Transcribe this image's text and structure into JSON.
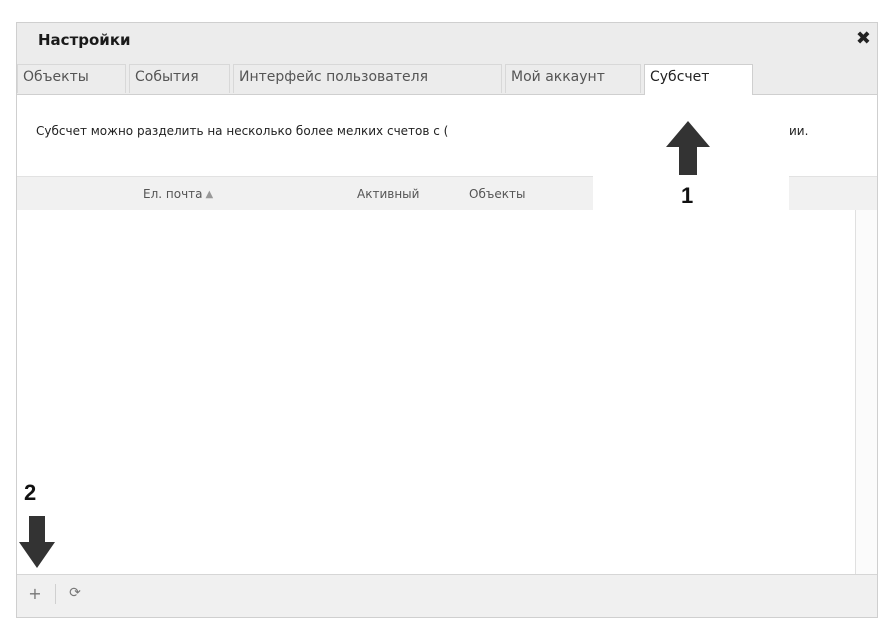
{
  "window": {
    "title": "Настройки"
  },
  "tabs": [
    {
      "label": "Объекты"
    },
    {
      "label": "События"
    },
    {
      "label": "Интерфейс пользователя"
    },
    {
      "label": "Мой аккаунт"
    },
    {
      "label": "Субсчет",
      "active": true
    }
  ],
  "description": {
    "text_visible": "Субсчет можно разделить на несколько более мелких счетов с (",
    "text_tail": "ии."
  },
  "grid": {
    "columns": [
      {
        "label": "Ел. почта",
        "sortable": true
      },
      {
        "label": "Активный"
      },
      {
        "label": "Объекты"
      },
      {
        "label": ":"
      }
    ]
  },
  "footer": {
    "add_icon": "plus-icon",
    "refresh_icon": "refresh-icon"
  },
  "annotations": {
    "arrow1_label": "1",
    "arrow2_label": "2"
  },
  "colors": {
    "chrome": "#ececec",
    "border": "#cfcfcf",
    "arrow": "#333333"
  }
}
